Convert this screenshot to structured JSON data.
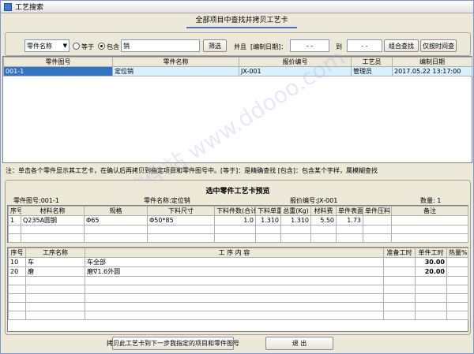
{
  "window": {
    "title": "工艺搜索"
  },
  "headline": "全部项目中查找并拷贝工艺卡",
  "search": {
    "field_select": "零件名称",
    "radio_equal": "等于",
    "radio_contains": "包含",
    "keyword": "销",
    "filter_btn": "筛选",
    "and_label": "并且",
    "date_label": "[编制日期]：",
    "date_from": "-  -",
    "to_label": "到",
    "date_to": "-  -",
    "combo_btn": "组合查找",
    "time_btn": "仅按时间查"
  },
  "results": {
    "columns": [
      "零件图号",
      "零件名称",
      "报价编号",
      "工艺员",
      "编制日期"
    ],
    "rows": [
      [
        "001-1",
        "定位销",
        "JX-001",
        "管理员",
        "2017.05.22 13:17:00"
      ]
    ]
  },
  "note": "注：单击各个零件显示其工艺卡，在确认后再拷贝到指定项目和零件图号中。[等于]：是精确查找 [包含]：包含某个字样，属模糊查找",
  "preview": {
    "title": "选中零件工艺卡预览",
    "part_no": "零件图号:001-1",
    "part_name": "零件名称:定位销",
    "quote_no": "报价编号:JX-001",
    "qty": "数量: 1",
    "mat_columns": [
      "序号",
      "材料名称",
      "规格",
      "下料尺寸",
      "下料件数(合计)",
      "下料单重",
      "总重(Kg)",
      "材料费",
      "单件表面积",
      "单件压料",
      "备注"
    ],
    "mat_rows": [
      [
        "1",
        "Q235A圆钢",
        "Φ65",
        "Φ50*85",
        "1.0",
        "1.310",
        "1.310",
        "5.50",
        "1.73",
        "",
        ""
      ]
    ],
    "proc_columns": [
      "序号",
      "工序名称",
      "工 序 内 容",
      "准备工时",
      "单件工时",
      "热量%"
    ],
    "proc_rows": [
      [
        "10",
        "车",
        "车全部",
        "",
        "30.00",
        ""
      ],
      [
        "20",
        "磨",
        "磨∇1.6外圆",
        "",
        "20.00",
        ""
      ]
    ]
  },
  "buttons": {
    "copy": "拷贝此工艺卡到下一步我指定的项目和零件图号",
    "exit": "退  出"
  },
  "watermark": "多多软件站 www.ddooo.com"
}
